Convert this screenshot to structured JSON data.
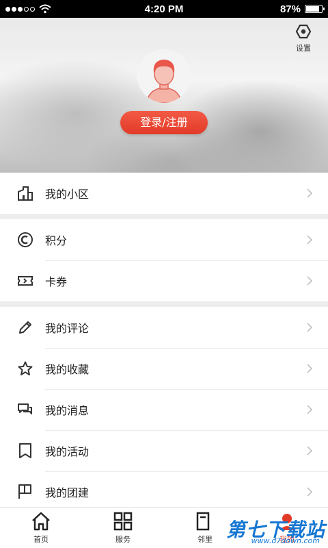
{
  "status_bar": {
    "signal_dots": 3,
    "signal_total": 5,
    "time": "4:20 PM",
    "battery_percent": "87%",
    "battery_level": 0.87
  },
  "header": {
    "settings_label": "设置",
    "login_button": "登录/注册"
  },
  "menu": {
    "groups": [
      [
        {
          "label": "我的小区",
          "icon": "building-icon"
        }
      ],
      [
        {
          "label": "积分",
          "icon": "points-coin-icon"
        },
        {
          "label": "卡券",
          "icon": "ticket-icon"
        }
      ],
      [
        {
          "label": "我的评论",
          "icon": "pencil-icon"
        },
        {
          "label": "我的收藏",
          "icon": "star-icon"
        },
        {
          "label": "我的消息",
          "icon": "chat-icon"
        },
        {
          "label": "我的活动",
          "icon": "bookmark-icon"
        },
        {
          "label": "我的团建",
          "icon": "flag-icon"
        }
      ]
    ]
  },
  "tabbar": {
    "items": [
      {
        "label": "首页",
        "icon": "home-icon"
      },
      {
        "label": "服务",
        "icon": "grid-icon"
      },
      {
        "label": "邻里",
        "icon": "community-icon"
      },
      {
        "label": "我的",
        "icon": "profile-icon",
        "active": true
      }
    ]
  },
  "watermark": {
    "text": "第七下载站",
    "url": "www.d7down.com"
  },
  "colors": {
    "accent": "#e23a28",
    "watermark": "#1677d2"
  }
}
